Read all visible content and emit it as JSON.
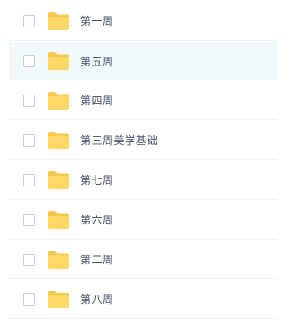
{
  "file_list": {
    "items": [
      {
        "name": "第一周",
        "icon": "folder-icon",
        "checked": false
      },
      {
        "name": "第五周",
        "icon": "folder-icon",
        "checked": false,
        "hovered": true
      },
      {
        "name": "第四周",
        "icon": "folder-icon",
        "checked": false
      },
      {
        "name": "第三周美学基础",
        "icon": "folder-icon",
        "checked": false
      },
      {
        "name": "第七周",
        "icon": "folder-icon",
        "checked": false
      },
      {
        "name": "第六周",
        "icon": "folder-icon",
        "checked": false
      },
      {
        "name": "第二周",
        "icon": "folder-icon",
        "checked": false
      },
      {
        "name": "第八周",
        "icon": "folder-icon",
        "checked": false
      }
    ]
  },
  "colors": {
    "folder_back": "#f5c84c",
    "folder_front": "#ffd866",
    "text": "#424e67",
    "hover_bg": "#f2f9fd"
  }
}
